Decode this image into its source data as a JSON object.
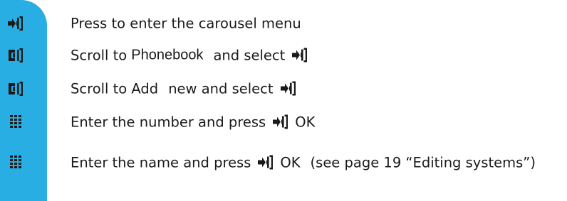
{
  "steps": [
    {
      "icon": "menu-ok-key-icon",
      "parts": [
        "Press to enter the carousel menu"
      ]
    },
    {
      "icon": "scroll-key-icon",
      "parts": [
        "Scroll to",
        "Phonebook",
        "and select"
      ]
    },
    {
      "icon": "scroll-key-icon",
      "parts": [
        "Scroll to Add",
        "new and select"
      ]
    },
    {
      "icon": "keypad-icon",
      "parts": [
        "Enter the number and press",
        "OK"
      ]
    },
    {
      "icon": "keypad-icon",
      "parts": [
        "Enter the name and press",
        "OK",
        "(see page 19 “Editing systems”)"
      ]
    }
  ],
  "colors": {
    "sidebar": "#29aee3",
    "text": "#1a1a1a"
  }
}
